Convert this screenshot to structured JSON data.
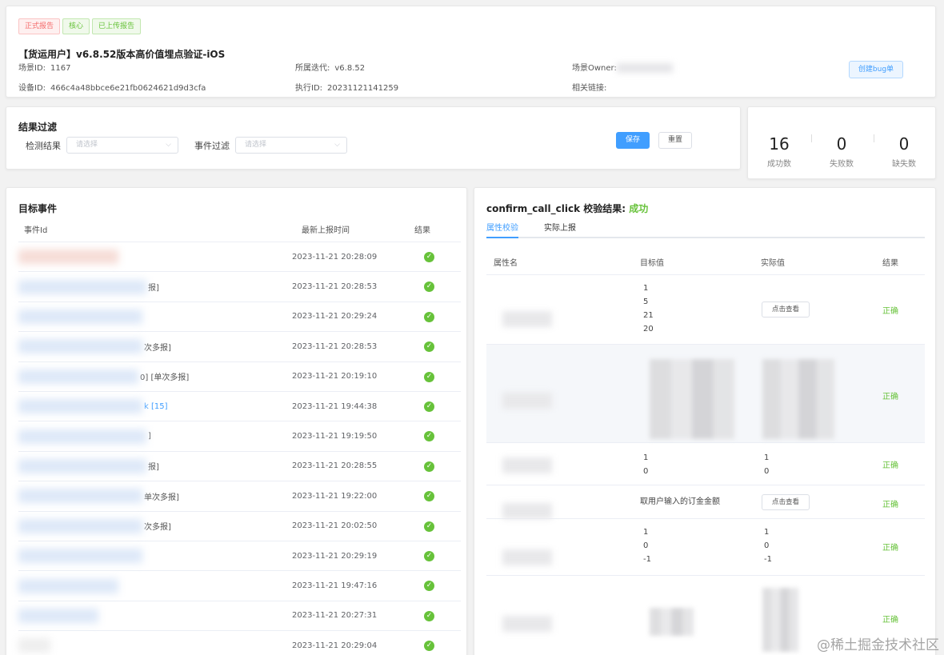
{
  "header": {
    "tags": [
      {
        "label": "正式报告",
        "tone": "red"
      },
      {
        "label": "核心",
        "tone": "green"
      },
      {
        "label": "已上传报告",
        "tone": "green"
      }
    ],
    "title": "【货运用户】v6.8.52版本高价值埋点验证-iOS",
    "scene_id_label": "场景ID:",
    "scene_id": "1167",
    "device_id_label": "设备ID:",
    "device_id": "466c4a48bbce6e21fb0624621d9d3cfa",
    "iteration_label": "所属迭代:",
    "iteration": "v6.8.52",
    "exec_id_label": "执行ID:",
    "exec_id": "20231121141259",
    "owner_label": "场景Owner:",
    "links_label": "相关链接:",
    "create_bug_label": "创建bug单"
  },
  "filter": {
    "title": "结果过滤",
    "result_label": "检测结果",
    "result_placeholder": "请选择",
    "event_label": "事件过滤",
    "event_placeholder": "请选择",
    "save_label": "保存",
    "reset_label": "重置"
  },
  "stats": {
    "success_value": "16",
    "success_label": "成功数",
    "fail_value": "0",
    "fail_label": "失败数",
    "missing_value": "0",
    "missing_label": "缺失数"
  },
  "events": {
    "title": "目标事件",
    "col_id": "事件Id",
    "col_time": "最新上报时间",
    "col_result": "结果",
    "rows": [
      {
        "suffix": "",
        "time": "2023-11-21 20:28:09"
      },
      {
        "suffix": "报]",
        "time": "2023-11-21 20:28:53"
      },
      {
        "suffix": "",
        "time": "2023-11-21 20:29:24"
      },
      {
        "suffix": "次多报]",
        "time": "2023-11-21 20:28:53"
      },
      {
        "suffix": "0] [单次多报]",
        "time": "2023-11-21 20:19:10"
      },
      {
        "suffix": "k [15]",
        "time": "2023-11-21 19:44:38"
      },
      {
        "suffix": "]",
        "time": "2023-11-21 19:19:50"
      },
      {
        "suffix": "报]",
        "time": "2023-11-21 20:28:55"
      },
      {
        "suffix": "单次多报]",
        "time": "2023-11-21 19:22:00"
      },
      {
        "suffix": "次多报]",
        "time": "2023-11-21 20:02:50"
      },
      {
        "suffix": "",
        "time": "2023-11-21 20:29:19"
      },
      {
        "suffix": "",
        "time": "2023-11-21 19:47:16"
      },
      {
        "suffix": "",
        "time": "2023-11-21 20:27:31"
      },
      {
        "suffix": "",
        "time": "2023-11-21 20:29:04"
      }
    ]
  },
  "detail": {
    "event_name": "confirm_call_click",
    "result_text": "校验结果:",
    "result_value": "成功",
    "tab_attr": "属性校验",
    "tab_actual": "实际上报",
    "col_attr": "属性名",
    "col_target": "目标值",
    "col_actual": "实际值",
    "col_result": "结果",
    "view_label": "点击查看",
    "correct_label": "正确",
    "rows": [
      {
        "target": "1\n5\n21\n20",
        "actual": "",
        "result": "正确"
      },
      {
        "target": "",
        "actual": "",
        "result": "正确"
      },
      {
        "target": "1\n0",
        "actual": "1\n0",
        "result": "正确"
      },
      {
        "target": "取用户输入的订金金额",
        "actual": "",
        "result": "正确"
      },
      {
        "target": "1\n0\n-1",
        "actual": "1\n0\n-1",
        "result": "正确"
      },
      {
        "target": "",
        "actual": "",
        "result": "正确"
      }
    ]
  },
  "watermark": "@稀土掘金技术社区"
}
